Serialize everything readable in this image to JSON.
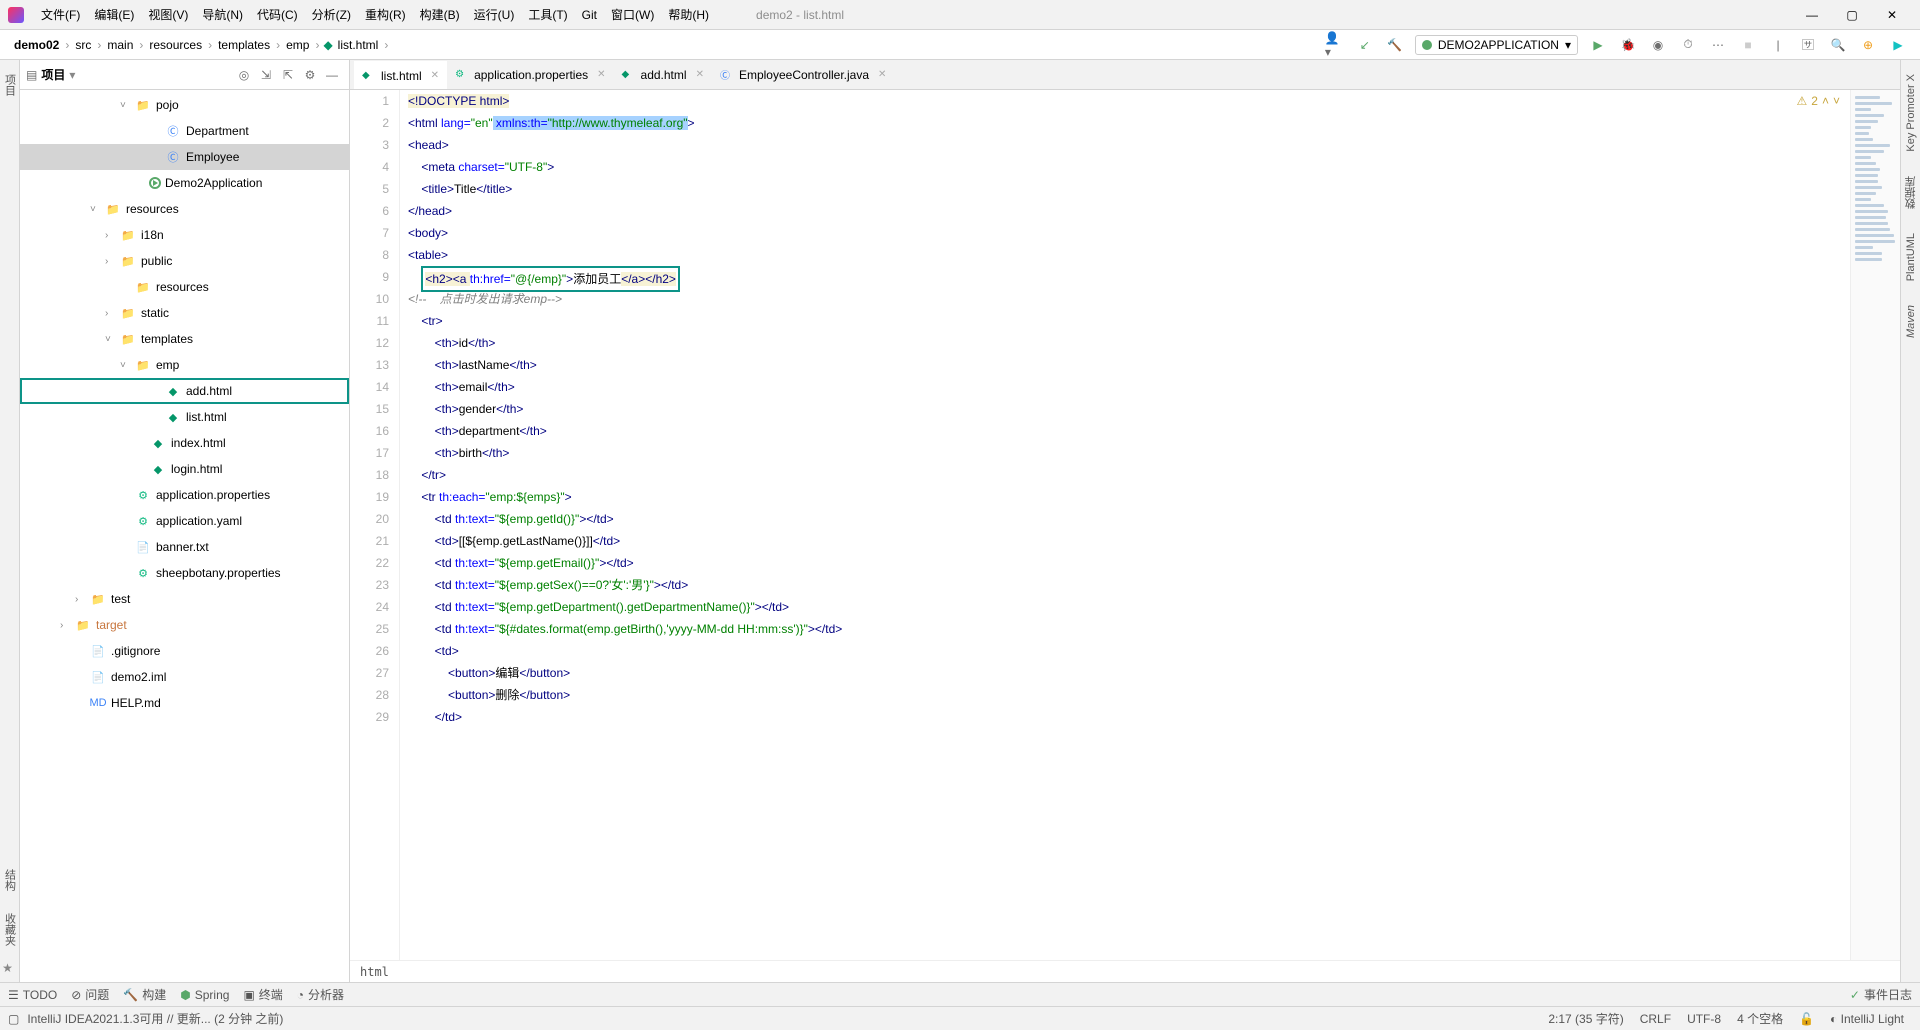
{
  "window_title": "demo2 - list.html",
  "menu": [
    "文件(F)",
    "编辑(E)",
    "视图(V)",
    "导航(N)",
    "代码(C)",
    "分析(Z)",
    "重构(R)",
    "构建(B)",
    "运行(U)",
    "工具(T)",
    "Git",
    "窗口(W)",
    "帮助(H)"
  ],
  "breadcrumbs": [
    "demo02",
    "src",
    "main",
    "resources",
    "templates",
    "emp",
    "list.html"
  ],
  "run_config": "DEMO2APPLICATION",
  "project_label": "项目",
  "left_tabs": [
    "项目"
  ],
  "right_tabs": [
    "Key Promoter X",
    "数据库",
    "PlantUML",
    "Maven"
  ],
  "left_bottom_tabs": [
    "结构",
    "收藏夹"
  ],
  "tree": {
    "pojo": "pojo",
    "department": "Department",
    "employee": "Employee",
    "demo2app": "Demo2Application",
    "resources": "resources",
    "i18n": "i18n",
    "public": "public",
    "resources2": "resources",
    "static": "static",
    "templates": "templates",
    "emp": "emp",
    "add": "add.html",
    "list": "list.html",
    "index": "index.html",
    "login": "login.html",
    "appprops": "application.properties",
    "appyaml": "application.yaml",
    "banner": "banner.txt",
    "sheep": "sheepbotany.properties",
    "test": "test",
    "target": "target",
    "gitignore": ".gitignore",
    "demo2iml": "demo2.iml",
    "help": "HELP.md"
  },
  "tabs": [
    {
      "label": "list.html",
      "active": true
    },
    {
      "label": "application.properties",
      "active": false
    },
    {
      "label": "add.html",
      "active": false
    },
    {
      "label": "EmployeeController.java",
      "active": false
    }
  ],
  "warning_count": "2",
  "code_lines": {
    "l1": "<!DOCTYPE html>",
    "l2a": "<html ",
    "l2b": "lang=",
    "l2c": "\"en\"",
    "l2d": " xmlns:th=",
    "l2e": "\"http://www.thymeleaf.org\"",
    "l2f": ">",
    "l3": "<head>",
    "l4a": "    <meta ",
    "l4b": "charset=",
    "l4c": "\"UTF-8\"",
    "l4d": ">",
    "l5a": "    <title>",
    "l5b": "Title",
    "l5c": "</title>",
    "l6": "</head>",
    "l7": "<body>",
    "l8": "<table>",
    "l9a": "    ",
    "l9b": "<h2><a ",
    "l9c": "th:href=",
    "l9d": "\"@{/emp}\"",
    "l9e": ">",
    "l9f": "添加员工",
    "l9g": "</a></h2>",
    "l10a": "<!--",
    "l10b": "    点击时发出请求emp-->",
    "l11": "    <tr>",
    "l12a": "        <th>",
    "l12b": "id",
    "l12c": "</th>",
    "l13a": "        <th>",
    "l13b": "lastName",
    "l13c": "</th>",
    "l14a": "        <th>",
    "l14b": "email",
    "l14c": "</th>",
    "l15a": "        <th>",
    "l15b": "gender",
    "l15c": "</th>",
    "l16a": "        <th>",
    "l16b": "department",
    "l16c": "</th>",
    "l17a": "        <th>",
    "l17b": "birth",
    "l17c": "</th>",
    "l18": "    </tr>",
    "l19a": "    <tr ",
    "l19b": "th:each=",
    "l19c": "\"emp:${emps}\"",
    "l19d": ">",
    "l20a": "        <td ",
    "l20b": "th:text=",
    "l20c": "\"${emp.getId()}\"",
    "l20d": "></td>",
    "l21a": "        <td>",
    "l21b": "[[${emp.getLastName()}]]",
    "l21c": "</td>",
    "l22a": "        <td ",
    "l22b": "th:text=",
    "l22c": "\"${emp.getEmail()}\"",
    "l22d": "></td>",
    "l23a": "        <td ",
    "l23b": "th:text=",
    "l23c": "\"${emp.getSex()==0?'女':'男'}\"",
    "l23d": "></td>",
    "l24a": "        <td ",
    "l24b": "th:text=",
    "l24c": "\"${emp.getDepartment().getDepartmentName()}\"",
    "l24d": "></td>",
    "l25a": "        <td ",
    "l25b": "th:text=",
    "l25c": "\"${#dates.format(emp.getBirth(),'yyyy-MM-dd HH:mm:ss')}\"",
    "l25d": "></td>",
    "l26": "        <td>",
    "l27a": "            <button>",
    "l27b": "编辑",
    "l27c": "</button>",
    "l28a": "            <button>",
    "l28b": "删除",
    "l28c": "</button>",
    "l29": "        </td>"
  },
  "breadcrumb_bottom": "html",
  "bottom_tools": [
    "TODO",
    "问题",
    "构建",
    "Spring",
    "终端",
    "分析器"
  ],
  "event_log": "事件日志",
  "status": {
    "update": "IntelliJ IDEA2021.1.3可用 // 更新... (2 分钟 之前)",
    "pos": "2:17 (35 字符)",
    "crlf": "CRLF",
    "encoding": "UTF-8",
    "indent": "4 个空格",
    "theme": "IntelliJ Light"
  }
}
